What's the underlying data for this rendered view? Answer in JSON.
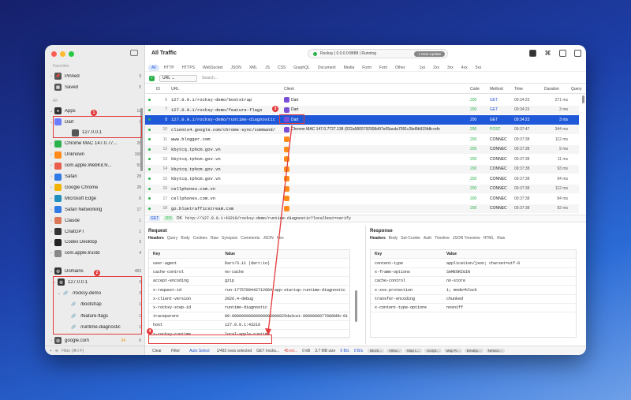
{
  "window": {
    "title": "All Traffic"
  },
  "status": {
    "label": "Rocksy | 0.0.0.0:8888 | Running",
    "update": "1 New Update"
  },
  "sidebar": {
    "favorites_label": "Favorites",
    "pinned": {
      "label": "Pinned",
      "count": "3"
    },
    "saved": {
      "label": "Saved",
      "count": "5"
    },
    "all_label": "All",
    "apps": {
      "label": "Apps",
      "count": "12"
    },
    "app_items": [
      {
        "label": "Dart",
        "count": "3",
        "color": "#6b7cff"
      },
      {
        "label": "127.0.0.1",
        "count": "",
        "color": "#555555"
      },
      {
        "label": "Chrome MAC 147.0.77...",
        "count": "28",
        "color": "#2bb24c"
      },
      {
        "label": "Unknown",
        "count": "168",
        "color": "#ff8c1a"
      },
      {
        "label": "com.apple.WebKit.N...",
        "count": "59",
        "color": "#e85d4b"
      },
      {
        "label": "Safari",
        "count": "28",
        "color": "#2f7ae5"
      },
      {
        "label": "Google Chrome",
        "count": "28",
        "color": "#f0b400"
      },
      {
        "label": "Microsoft Edge",
        "count": "6",
        "color": "#1e8fbf"
      },
      {
        "label": "Safari Networking",
        "count": "17",
        "color": "#2f7ae5"
      },
      {
        "label": "Claude",
        "count": "1",
        "color": "#d97757"
      },
      {
        "label": "ChatGPT",
        "count": "1",
        "color": "#333333"
      },
      {
        "label": "Codex Desktop",
        "count": "3",
        "color": "#222222"
      },
      {
        "label": "com.apple.trustd",
        "count": "4",
        "color": "#888888"
      }
    ],
    "domains": {
      "label": "Domains",
      "count": "483"
    },
    "domain_items": [
      {
        "label": "127.0.0.1",
        "count": "3"
      },
      {
        "label": "/rocksy-demo",
        "count": "3"
      },
      {
        "label": "/bootstrap",
        "count": "1"
      },
      {
        "label": "/feature-flags",
        "count": "1"
      },
      {
        "label": "/runtime-diagnostic",
        "count": "1"
      }
    ],
    "google": {
      "label": "google.com",
      "count": "6",
      "extra": "34"
    },
    "filter_placeholder": "Filter (⌘⇧F)"
  },
  "tabs": [
    "All",
    "HTTP",
    "HTTPS",
    "WebSocket",
    "JSON",
    "XML",
    "JS",
    "CSS",
    "GraphQL",
    "Document",
    "Media",
    "Form",
    "Font",
    "Other",
    "1xx",
    "2xx",
    "3xx",
    "4xx",
    "5xx"
  ],
  "filter": {
    "field": "URL",
    "placeholder": "Search..."
  },
  "columns": {
    "id": "ID",
    "url": "URL",
    "client": "Client",
    "code": "Code",
    "method": "Method",
    "time": "Time",
    "duration": "Duration",
    "query": "Query"
  },
  "rows": [
    {
      "id": "6",
      "url": "127.0.0.1/rocksy-demo/bootstrap",
      "client": "Dart",
      "client_color": "#7a4fd6",
      "code": "200",
      "method": "GET",
      "time": "09:34:23",
      "duration": "271 ms"
    },
    {
      "id": "7",
      "url": "127.0.0.1/rocksy-demo/feature-flags",
      "client": "Dart",
      "client_color": "#7a4fd6",
      "code": "200",
      "method": "GET",
      "time": "09:34:23",
      "duration": "3 ms"
    },
    {
      "id": "8",
      "url": "127.0.0.1/rocksy-demo/runtime-diagnostic",
      "client": "Dart",
      "client_color": "#7a4fd6",
      "code": "200",
      "method": "GET",
      "time": "09:34:23",
      "duration": "3 ms"
    },
    {
      "id": "10",
      "url": "clients4.google.com/chrome-sync/command/",
      "client": "Chrome MAC 147.0.7727.138 (022a5805792996d97e05acda7091c2bd9b915fdb-refs",
      "client_color": "#7a4fd6",
      "code": "200",
      "method": "POST",
      "time": "09:37:47",
      "duration": "344 ms"
    },
    {
      "id": "11",
      "url": "www.blogger.com",
      "client": "",
      "client_color": "#ff8c1a",
      "code": "200",
      "method": "CONNEC",
      "time": "09:37:38",
      "duration": "112 ms"
    },
    {
      "id": "12",
      "url": "kbytcq.tphcm.gov.vn",
      "client": "",
      "client_color": "#ff8c1a",
      "code": "200",
      "method": "CONNEC",
      "time": "09:37:38",
      "duration": "9 ms"
    },
    {
      "id": "13",
      "url": "kbytcq.tphcm.gov.vn",
      "client": "",
      "client_color": "#ff8c1a",
      "code": "200",
      "method": "CONNEC",
      "time": "09:37:38",
      "duration": "11 ms"
    },
    {
      "id": "14",
      "url": "kbytcq.tphcm.gov.vn",
      "client": "",
      "client_color": "#ff8c1a",
      "code": "200",
      "method": "CONNEC",
      "time": "09:37:38",
      "duration": "93 ms"
    },
    {
      "id": "15",
      "url": "kbytcq.tphcm.gov.vn",
      "client": "",
      "client_color": "#ff8c1a",
      "code": "200",
      "method": "CONNEC",
      "time": "09:37:38",
      "duration": "94 ms"
    },
    {
      "id": "16",
      "url": "cellphones.com.vn",
      "client": "",
      "client_color": "#ff8c1a",
      "code": "200",
      "method": "CONNEC",
      "time": "09:37:38",
      "duration": "112 ms"
    },
    {
      "id": "17",
      "url": "cellphones.com.vn",
      "client": "",
      "client_color": "#ff8c1a",
      "code": "200",
      "method": "CONNEC",
      "time": "09:37:38",
      "duration": "84 ms"
    },
    {
      "id": "18",
      "url": "go.bluetrafficstream.com",
      "client": "",
      "client_color": "#ff8c1a",
      "code": "200",
      "method": "CONNEC",
      "time": "09:37:38",
      "duration": "92 ms"
    }
  ],
  "urlbar": {
    "method": "GET",
    "code": "200",
    "ok": "OK",
    "url": "http://127.0.0.1:43210/rocksy-demo/runtime-diagnostic?localhost=verify"
  },
  "request": {
    "title": "Request",
    "tabs": [
      "Headers",
      "Query",
      "Body",
      "Cookies",
      "Raw",
      "Synopsis",
      "Comments",
      "JSON",
      "Hex"
    ],
    "key_label": "Key",
    "value_label": "Value",
    "headers": [
      {
        "k": "user-agent",
        "v": "Dart/3.11 (dart:io)"
      },
      {
        "k": "cache-control",
        "v": "no-cache"
      },
      {
        "k": "accept-encoding",
        "v": "gzip"
      },
      {
        "k": "x-request-id",
        "v": "run-1775789442712084-app-startup-runtime-diagnostic"
      },
      {
        "k": "x-client-version",
        "v": "2026.4-debug"
      },
      {
        "k": "x-rocksy-step-id",
        "v": "runtime-diagnostic"
      },
      {
        "k": "traceparent",
        "v": "00-00000000000000000000025da3ce1-0000000077886bbb-01"
      },
      {
        "k": "host",
        "v": "127.0.0.1:43210"
      },
      {
        "k": "x-rocksy-runtime",
        "v": "local-apple-runtime"
      }
    ]
  },
  "response": {
    "title": "Response",
    "tabs": [
      "Headers",
      "Body",
      "Set-Cookie",
      "Auth",
      "Timeline",
      "JSON Treeview",
      "HTML",
      "Raw"
    ],
    "key_label": "Key",
    "value_label": "Value",
    "headers": [
      {
        "k": "content-type",
        "v": "application/json; charset=utf-8"
      },
      {
        "k": "x-frame-options",
        "v": "SAMEORIGIN"
      },
      {
        "k": "cache-control",
        "v": "no-store"
      },
      {
        "k": "x-xss-protection",
        "v": "1; mode=block"
      },
      {
        "k": "transfer-encoding",
        "v": "chunked"
      },
      {
        "k": "x-content-type-options",
        "v": "nosniff"
      }
    ]
  },
  "footer": {
    "clear": "Clear",
    "filter": "Filter",
    "auto": "Auto Select",
    "stats": "1/492 rows selected",
    "req": "GET /rocks...",
    "err": "45 err...",
    "mem": "0 kB",
    "size": "3.7 MB size",
    "up": "0 B/s",
    "down": "0 B/s",
    "chips": [
      "Block...",
      "Allow...",
      "Map L...",
      "Script...",
      "Map R...",
      "Breakp...",
      "Networ..."
    ]
  },
  "annotations": [
    "1",
    "2",
    "3",
    "4"
  ]
}
